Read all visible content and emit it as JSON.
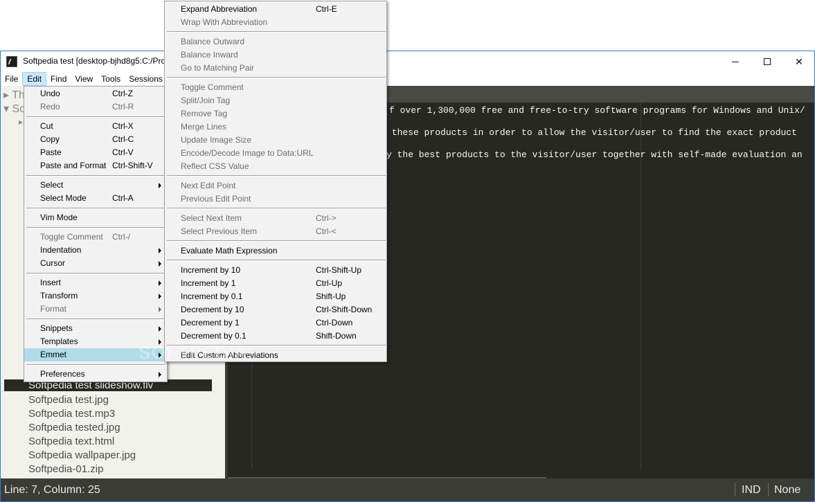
{
  "window": {
    "title": "Softpedia test [desktop-bjhd8g5:C:/Pro",
    "menubar": [
      "File",
      "Edit",
      "Find",
      "View",
      "Tools",
      "Sessions"
    ],
    "active_menu": "Edit"
  },
  "sidebar": {
    "tree": [
      {
        "label": "Th",
        "icon": "triangle-right-icon"
      },
      {
        "label": "So",
        "icon": "triangle-down-icon"
      }
    ],
    "files": [
      {
        "name": "Softpedia test slideshow.flv",
        "selected": true
      },
      {
        "name": "Softpedia test.jpg"
      },
      {
        "name": "Softpedia test.mp3"
      },
      {
        "name": "Softpedia tested.jpg"
      },
      {
        "name": "Softpedia text.html"
      },
      {
        "name": "Softpedia wallpaper.jpg"
      },
      {
        "name": "Softpedia-01.zip"
      }
    ]
  },
  "editor": {
    "lines": [
      "f over 1,300,000 free and free-to-try software programs for Windows and Unix/",
      " these products in order to allow the visitor/user to find the exact product",
      "y the best products to the visitor/user together with self-made evaluation an"
    ]
  },
  "statusbar": {
    "position": "Line: 7, Column: 25",
    "indent": "IND",
    "syntax": "None"
  },
  "edit_menu": {
    "items": [
      {
        "label": "Undo",
        "shortcut": "Ctrl-Z"
      },
      {
        "label": "Redo",
        "shortcut": "Ctrl-R",
        "disabled": true
      },
      {
        "label": "Cut",
        "shortcut": "Ctrl-X"
      },
      {
        "label": "Copy",
        "shortcut": "Ctrl-C"
      },
      {
        "label": "Paste",
        "shortcut": "Ctrl-V"
      },
      {
        "label": "Paste and Format",
        "shortcut": "Ctrl-Shift-V"
      },
      {
        "label": "Select",
        "submenu": true
      },
      {
        "label": "Select Mode",
        "shortcut": "Ctrl-A"
      },
      {
        "label": "Vim Mode"
      },
      {
        "label": "Toggle Comment",
        "shortcut": "Ctrl-/",
        "disabled": true
      },
      {
        "label": "Indentation",
        "submenu": true
      },
      {
        "label": "Cursor",
        "submenu": true
      },
      {
        "label": "Insert",
        "submenu": true
      },
      {
        "label": "Transform",
        "submenu": true
      },
      {
        "label": "Format",
        "submenu": true,
        "disabled": true
      },
      {
        "label": "Snippets",
        "submenu": true
      },
      {
        "label": "Templates",
        "submenu": true
      },
      {
        "label": "Emmet",
        "submenu": true,
        "highlighted": true
      },
      {
        "label": "Preferences",
        "submenu": true
      }
    ]
  },
  "emmet_menu": {
    "items": [
      {
        "label": "Expand Abbreviation",
        "shortcut": "Ctrl-E"
      },
      {
        "label": "Wrap With Abbreviation",
        "disabled": true
      },
      {
        "label": "Balance Outward",
        "disabled": true
      },
      {
        "label": "Balance Inward",
        "disabled": true
      },
      {
        "label": "Go to Matching Pair",
        "disabled": true
      },
      {
        "label": "Toggle Comment",
        "disabled": true
      },
      {
        "label": "Split/Join Tag",
        "disabled": true
      },
      {
        "label": "Remove Tag",
        "disabled": true
      },
      {
        "label": "Merge Lines",
        "disabled": true
      },
      {
        "label": "Update Image Size",
        "disabled": true
      },
      {
        "label": "Encode/Decode Image to Data:URL",
        "disabled": true
      },
      {
        "label": "Reflect CSS Value",
        "disabled": true
      },
      {
        "label": "Next Edit Point",
        "disabled": true
      },
      {
        "label": "Previous Edit Point",
        "disabled": true
      },
      {
        "label": "Select Next Item",
        "shortcut": "Ctrl->",
        "disabled": true
      },
      {
        "label": "Select Previous Item",
        "shortcut": "Ctrl-<",
        "disabled": true
      },
      {
        "label": "Evaluate Math Expression"
      },
      {
        "label": "Increment by 10",
        "shortcut": "Ctrl-Shift-Up"
      },
      {
        "label": "Increment by 1",
        "shortcut": "Ctrl-Up"
      },
      {
        "label": "Increment by 0.1",
        "shortcut": "Shift-Up"
      },
      {
        "label": "Decrement by 10",
        "shortcut": "Ctrl-Shift-Down"
      },
      {
        "label": "Decrement by 1",
        "shortcut": "Ctrl-Down"
      },
      {
        "label": "Decrement by 0.1",
        "shortcut": "Shift-Down"
      },
      {
        "label": "Edit Custom Abbreviations"
      }
    ]
  },
  "colors": {
    "editor_bg": "#272822",
    "sidebar_bg": "#f2f2ed",
    "statusbar_bg": "#3c3c37",
    "menu_highlight": "#b0dbe8",
    "window_border": "#2b7bd8"
  },
  "watermark": "SOFTPEDIA"
}
